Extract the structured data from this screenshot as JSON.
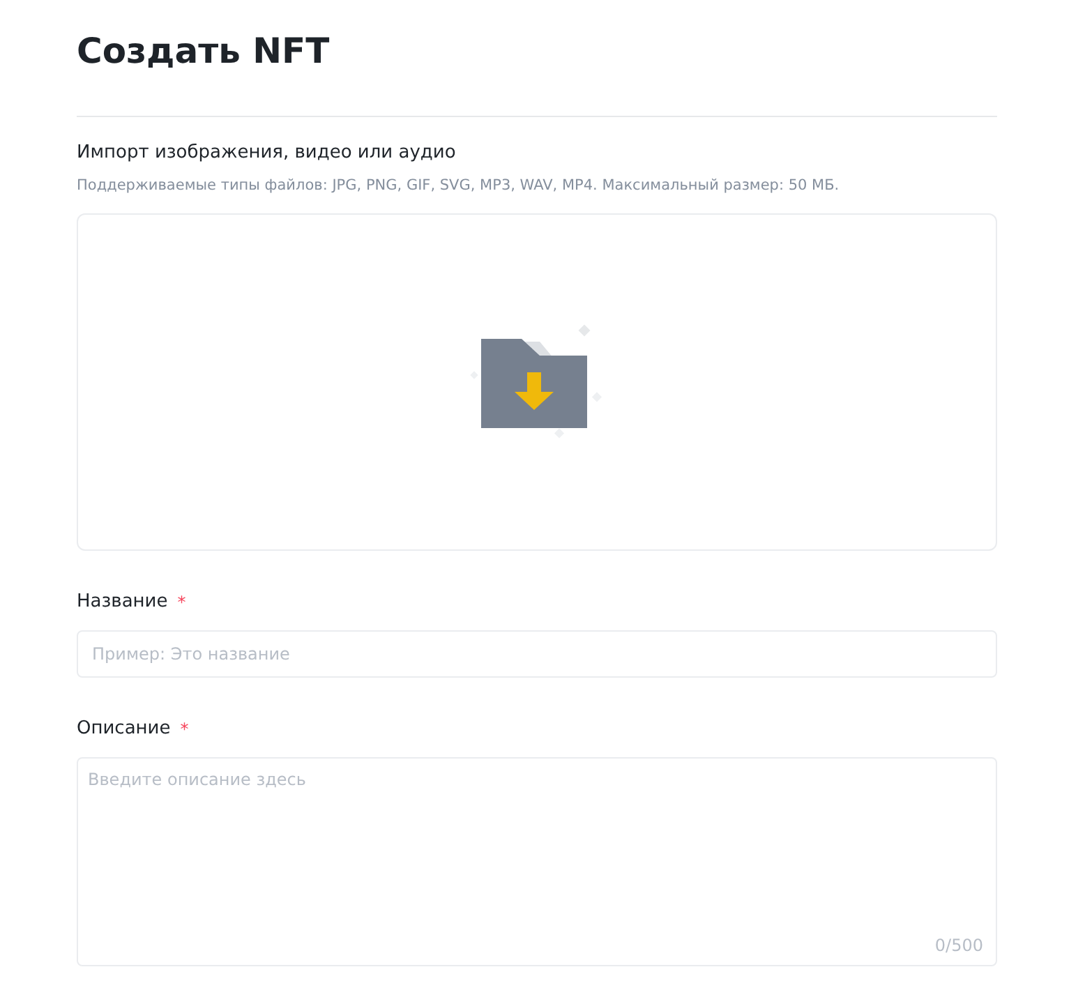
{
  "title": "Создать NFT",
  "upload": {
    "label": "Импорт изображения, видео или аудио",
    "hint": "Поддерживаемые типы файлов: JPG, PNG, GIF, SVG, MP3, WAV, MP4. Максимальный размер: 50 МБ."
  },
  "fields": [
    {
      "kind": "input",
      "label": "Название",
      "required_mark": "*",
      "placeholder": "Пример: Это название"
    },
    {
      "kind": "textarea",
      "label": "Описание",
      "required_mark": "*",
      "placeholder": "Введите описание здесь",
      "counter": "0/500"
    }
  ]
}
